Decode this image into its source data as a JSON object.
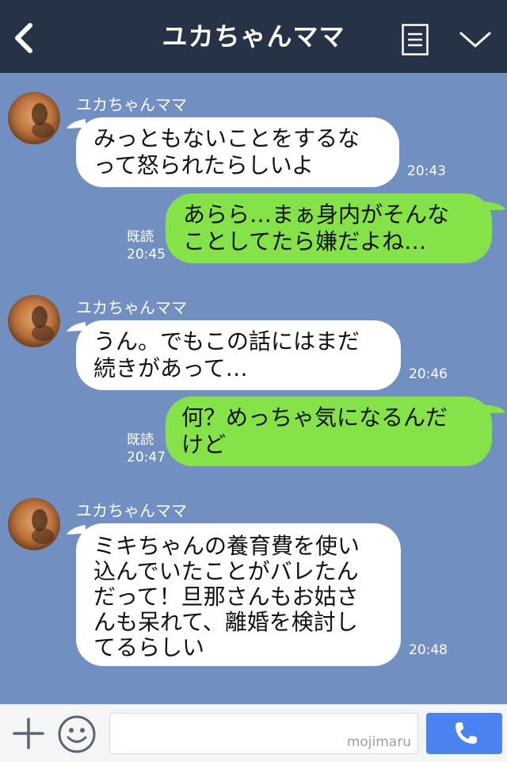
{
  "header": {
    "title": "ユカちゃんママ",
    "back_icon": "chevron-left-icon",
    "menu_icon": "menu-list-icon",
    "dropdown_icon": "chevron-down-icon"
  },
  "colors": {
    "header_bg": "#263246",
    "chat_bg": "#7190c1",
    "incoming_bubble": "#ffffff",
    "outgoing_bubble": "#85e249",
    "send_button": "#4b82ef"
  },
  "messages": [
    {
      "direction": "in",
      "sender": "ユカちゃんママ",
      "lines": [
        "みっともないことをするな",
        "って怒られたらしいよ"
      ],
      "time": "20:43"
    },
    {
      "direction": "out",
      "read": "既読",
      "lines": [
        "あらら…まぁ身内がそんな",
        "ことしてたら嫌だよね…"
      ],
      "time": "20:45"
    },
    {
      "direction": "in",
      "sender": "ユカちゃんママ",
      "lines": [
        "うん。でもこの話にはまだ",
        "続きがあって…"
      ],
      "time": "20:46"
    },
    {
      "direction": "out",
      "read": "既読",
      "lines": [
        "何？めっちゃ気になるんだ",
        "けど"
      ],
      "time": "20:47"
    },
    {
      "direction": "in",
      "sender": "ユカちゃんママ",
      "lines": [
        "ミキちゃんの養育費を使い",
        "込んでいたことがバレたん",
        "だって！旦那さんもお姑さ",
        "んも呆れて、離婚を検討し",
        "てるらしい"
      ],
      "time": "20:48"
    }
  ],
  "footer": {
    "input_value": "",
    "watermark": "mojimaru",
    "plus_icon": "plus-icon",
    "emoji_icon": "smiley-icon",
    "call_icon": "phone-icon"
  }
}
